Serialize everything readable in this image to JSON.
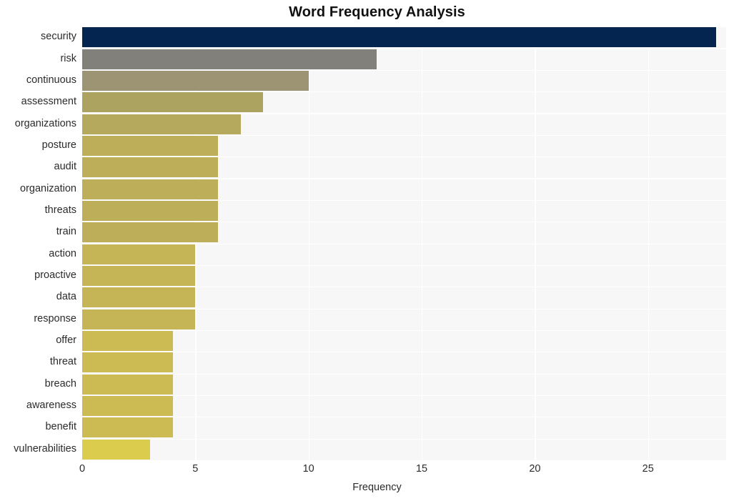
{
  "chart_data": {
    "type": "bar",
    "orientation": "horizontal",
    "title": "Word Frequency Analysis",
    "xlabel": "Frequency",
    "ylabel": "",
    "xlim": [
      0,
      28.45
    ],
    "xticks": [
      0,
      5,
      10,
      15,
      20,
      25
    ],
    "xtick_labels": [
      "0",
      "5",
      "10",
      "15",
      "20",
      "25"
    ],
    "grid": true,
    "grid_color": "#ffffff",
    "plot_background": "#f7f7f7",
    "figure_background": "#ffffff",
    "legend": null,
    "categories": [
      "security",
      "risk",
      "continuous",
      "assessment",
      "organizations",
      "posture",
      "audit",
      "organization",
      "threats",
      "train",
      "action",
      "proactive",
      "data",
      "response",
      "offer",
      "threat",
      "breach",
      "awareness",
      "benefit",
      "vulnerabilities"
    ],
    "values": [
      28,
      13,
      10,
      8,
      7,
      6,
      6,
      6,
      6,
      6,
      5,
      5,
      5,
      5,
      4,
      4,
      4,
      4,
      4,
      3
    ],
    "bar_colors": [
      "#03254f",
      "#82807b",
      "#9c9473",
      "#ada361",
      "#b5a95d",
      "#bdae59",
      "#bdae59",
      "#bdae59",
      "#bdae59",
      "#bdae59",
      "#c5b556",
      "#c5b556",
      "#c5b556",
      "#c5b556",
      "#ccbb52",
      "#ccbb52",
      "#ccbb52",
      "#ccbb52",
      "#ccbb52",
      "#dbcc4e"
    ]
  }
}
